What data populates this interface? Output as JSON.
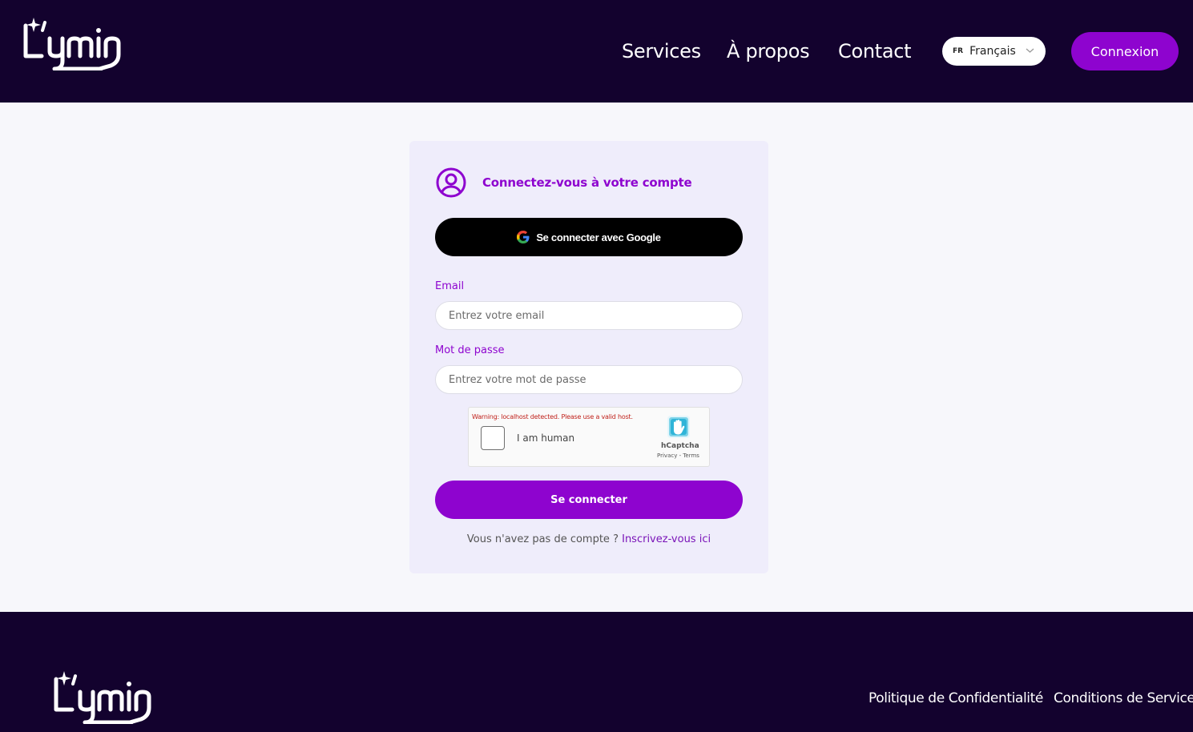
{
  "header": {
    "brand": "Lumin",
    "nav": {
      "services": "Services",
      "about": "À propos",
      "contact": "Contact"
    },
    "language": {
      "code": "FR",
      "label": "Français"
    },
    "login_button": "Connexion"
  },
  "login_card": {
    "title": "Connectez-vous à votre compte",
    "google_button": "Se connecter avec Google",
    "email_label": "Email",
    "email_placeholder": "Entrez votre email",
    "email_value": "",
    "password_label": "Mot de passe",
    "password_placeholder": "Entrez votre mot de passe",
    "password_value": "",
    "captcha": {
      "warning": "Warning: localhost detected. Please use a valid host.",
      "label": "I am human",
      "brand": "hCaptcha",
      "privacy": "Privacy",
      "separator": " - ",
      "terms": "Terms",
      "checked": false
    },
    "submit_button": "Se connecter",
    "signup_prompt": "Vous n'avez pas de compte ?",
    "signup_link": "Inscrivez-vous ici"
  },
  "footer": {
    "brand": "Lumin",
    "privacy_link": "Politique de Confidentialité",
    "terms_link": "Conditions de Service"
  },
  "colors": {
    "header_bg": "#13022e",
    "accent": "#8e04cf",
    "card_bg": "#efedfb",
    "page_bg": "#f7f7fb",
    "google_button_bg": "#000000",
    "captcha_warning": "#c0211b"
  },
  "icons": {
    "user": "user-circle-icon",
    "google": "google-g-icon",
    "chevron": "chevron-down-icon",
    "captcha": "hcaptcha-hand-icon",
    "sparkle": "sparkle-icon"
  }
}
